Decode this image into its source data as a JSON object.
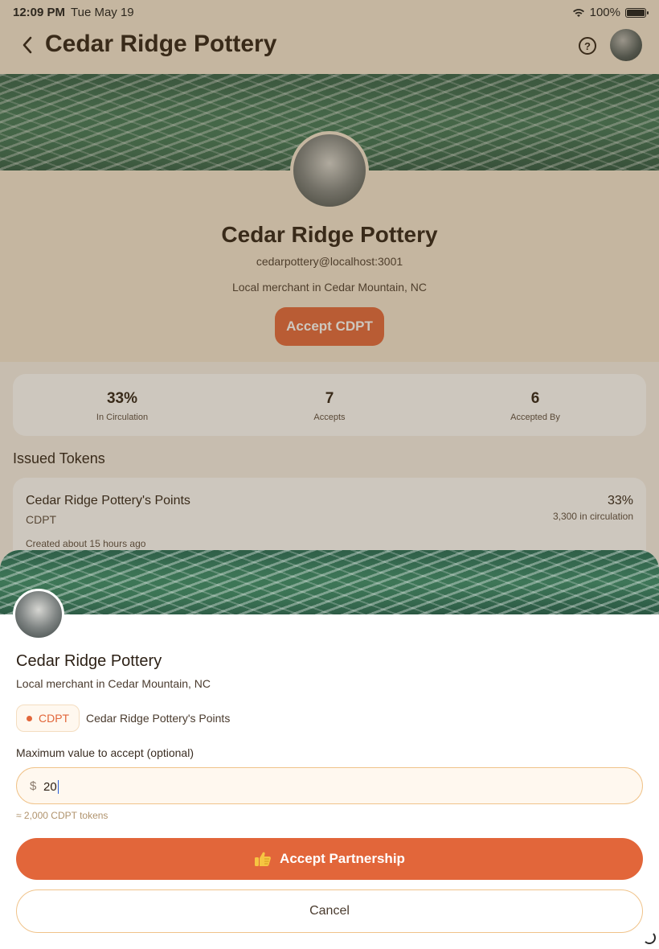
{
  "status_bar": {
    "time": "12:09 PM",
    "date": "Tue May 19",
    "battery": "100%"
  },
  "nav": {
    "title": "Cedar Ridge Pottery",
    "help_symbol": "?"
  },
  "profile": {
    "name": "Cedar Ridge Pottery",
    "handle": "cedarpottery@localhost:3001",
    "description": "Local merchant in Cedar Mountain, NC",
    "accept_button": "Accept CDPT"
  },
  "stats": [
    {
      "value": "33%",
      "label": "In Circulation"
    },
    {
      "value": "7",
      "label": "Accepts"
    },
    {
      "value": "6",
      "label": "Accepted By"
    }
  ],
  "issued_tokens": {
    "title": "Issued Tokens",
    "token": {
      "name": "Cedar Ridge Pottery's Points",
      "symbol": "CDPT",
      "percent": "33%",
      "circulation": "3,300 in circulation",
      "created": "Created about 15 hours ago"
    }
  },
  "sheet": {
    "name": "Cedar Ridge Pottery",
    "description": "Local merchant in Cedar Mountain, NC",
    "chip_symbol": "CDPT",
    "token_name": "Cedar Ridge Pottery's Points",
    "field_label": "Maximum value to accept (optional)",
    "currency_symbol": "$",
    "amount_value": "20",
    "hint": "≈ 2,000 CDPT tokens",
    "primary_button": "Accept Partnership",
    "primary_button_icon": "thumbs-up-icon",
    "cancel_button": "Cancel"
  },
  "colors": {
    "accent": "#e2663a",
    "header_bg": "#f4e7d4",
    "input_border": "#f0c38a"
  }
}
